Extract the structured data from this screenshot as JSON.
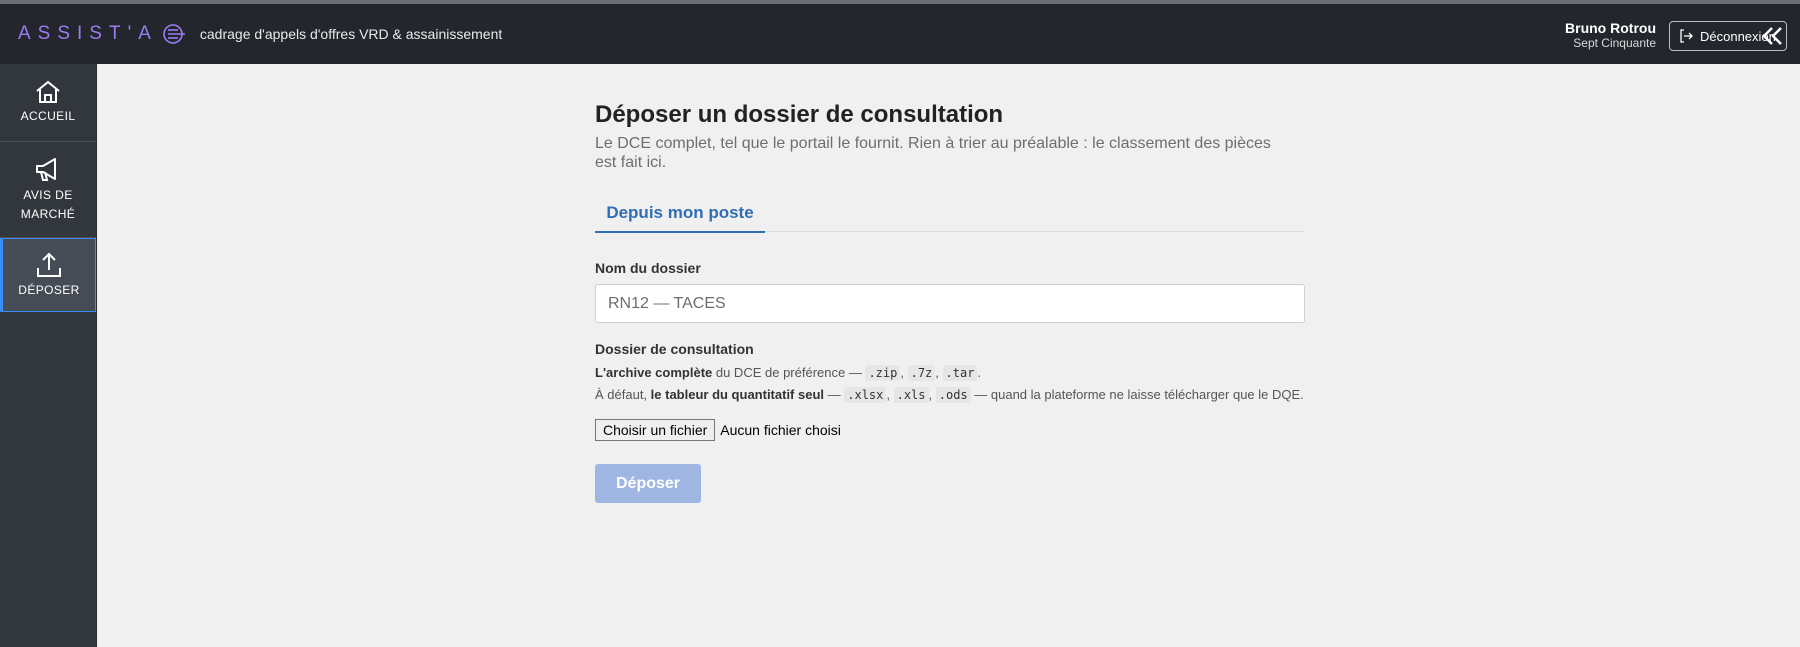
{
  "header": {
    "logo_text": "ASSIST'A",
    "tagline": "cadrage d'appels d'offres VRD & assainissement",
    "user_name": "Bruno Rotrou",
    "user_org": "Sept Cinquante",
    "logout_label": "Déconnexion"
  },
  "sidebar": {
    "items": [
      {
        "label": "ACCUEIL",
        "icon": "home-icon"
      },
      {
        "label_line1": "AVIS DE",
        "label_line2": "MARCHÉ",
        "icon": "megaphone-icon"
      },
      {
        "label": "DÉPOSER",
        "icon": "upload-icon",
        "active": true
      }
    ]
  },
  "main": {
    "title": "Déposer un dossier de consultation",
    "subtitle": "Le DCE complet, tel que le portail le fournit. Rien à trier au préalable : le classement des pièces est fait ici.",
    "tabs": [
      {
        "label": "Depuis mon poste",
        "active": true
      }
    ],
    "name_label": "Nom du dossier",
    "name_value": "RN12 — TACES",
    "file_label": "Dossier de consultation",
    "help": {
      "line1_bold": "L'archive complète",
      "line1_text": " du DCE de préférence — ",
      "ext_zip": ".zip",
      "ext_7z": ".7z",
      "ext_tar": ".tar",
      "line2_prefix": "À défaut, ",
      "line2_bold": "le tableur du quantitatif seul",
      "dash": " — ",
      "ext_xlsx": ".xlsx",
      "ext_xls": ".xls",
      "ext_ods": ".ods",
      "line2_suffix": " — quand la plateforme ne laisse télécharger que le DQE."
    },
    "file_button": "Choisir un fichier",
    "file_status": "Aucun fichier choisi",
    "submit_label": "Déposer"
  },
  "colors": {
    "topbar": "#23272d",
    "sidebar": "#32373e",
    "accent": "#2f6eb7",
    "logo": "#9a7cf0",
    "submit_disabled": "#9fb6e2"
  }
}
